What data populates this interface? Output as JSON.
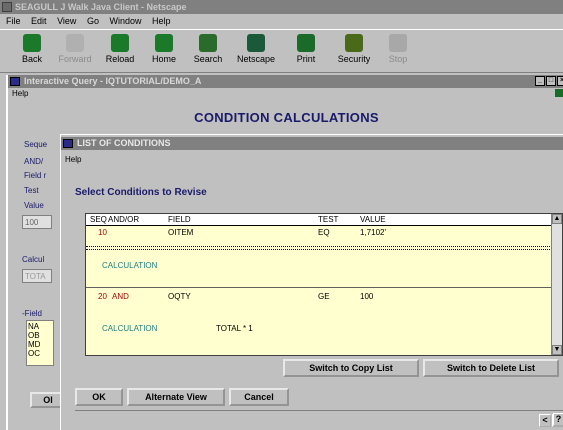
{
  "netscape": {
    "title": "SEAGULL J Walk Java Client - Netscape",
    "menu": [
      "File",
      "Edit",
      "View",
      "Go",
      "Window",
      "Help"
    ],
    "toolbar": [
      {
        "label": "Back",
        "icon": "back-arrow-icon",
        "color": "#1a7a2a",
        "disabled": false
      },
      {
        "label": "Forward",
        "icon": "forward-arrow-icon",
        "color": "#8a8a8a",
        "disabled": true
      },
      {
        "label": "Reload",
        "icon": "reload-icon",
        "color": "#1a7a2a",
        "disabled": false
      },
      {
        "label": "Home",
        "icon": "home-icon",
        "color": "#1a7a2a",
        "disabled": false
      },
      {
        "label": "Search",
        "icon": "search-icon",
        "color": "#1a7a2a",
        "disabled": false
      },
      {
        "label": "Netscape",
        "icon": "netscape-icon",
        "color": "#1a7a2a",
        "disabled": false
      },
      {
        "label": "Print",
        "icon": "print-icon",
        "color": "#1a7a2a",
        "disabled": false
      },
      {
        "label": "Security",
        "icon": "security-icon",
        "color": "#1a7a2a",
        "disabled": false
      },
      {
        "label": "Stop",
        "icon": "stop-icon",
        "color": "#8a8a8a",
        "disabled": true
      }
    ]
  },
  "iq": {
    "title": "Interactive Query - IQTUTORIAL/DEMO_A",
    "menu_help": "Help",
    "heading": "CONDITION CALCULATIONS",
    "bg_labels": [
      "Seque",
      "AND/",
      "Field r",
      "Test",
      "Value"
    ],
    "bg_field_value": "100",
    "bg_calc_label": "Calcul",
    "bg_calc_value": "TOTA",
    "bg_field_label": "-Field",
    "bg_list": [
      "NA",
      "OB",
      "MD",
      "OC"
    ],
    "bg_ok": "Ol",
    "accent": "#1a1a6a"
  },
  "conditions": {
    "title": "LIST OF CONDITIONS",
    "menu_help": "Help",
    "heading": "Select Conditions to Revise",
    "columns": {
      "seq": "SEQ",
      "andor": "AND/OR",
      "field": "FIELD",
      "test": "TEST",
      "value": "VALUE"
    },
    "rows": [
      {
        "seq": "10",
        "andor": "",
        "field": "OITEM",
        "test": "EQ",
        "value": "1,7102'",
        "calc_label": "CALCULATION",
        "calc_value": ""
      },
      {
        "seq": "20",
        "andor": "AND",
        "field": "OQTY",
        "test": "GE",
        "value": "100",
        "calc_label": "CALCULATION",
        "calc_value": "TOTAL * 1"
      }
    ],
    "buttons": {
      "switch_copy": "Switch to Copy List",
      "switch_delete": "Switch to Delete List",
      "ok": "OK",
      "alternate_view": "Alternate View",
      "cancel": "Cancel"
    },
    "status_buttons": [
      "<",
      ">",
      "?"
    ]
  }
}
